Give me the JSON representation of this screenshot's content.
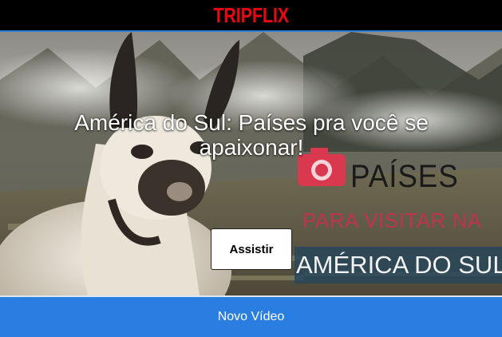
{
  "header": {
    "logo_text": "TRIPFLIX",
    "logo_color": "#e50914",
    "accent_line_color": "#2f7fd4"
  },
  "hero": {
    "title": "América do Sul: Países pra você se apaixonar!",
    "watch_button_label": "Assistir",
    "poster": {
      "line1": "PAÍSES",
      "line2": "PARA VISITAR NA",
      "line3": "AMÉRICA DO SUL",
      "camera_icon": "camera-icon"
    }
  },
  "footer": {
    "new_video_label": "Novo Vídeo",
    "bar_color": "#2a7de1"
  }
}
